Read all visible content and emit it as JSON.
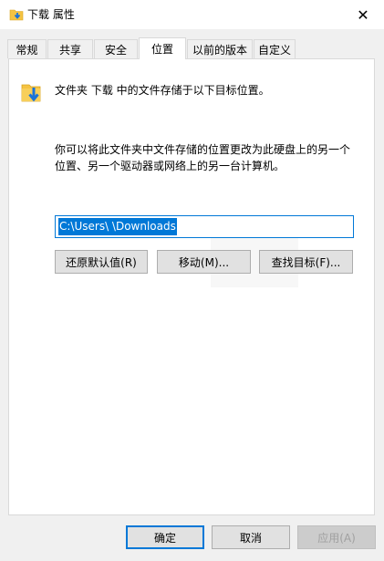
{
  "window": {
    "title": "下载 属性"
  },
  "tabs": [
    {
      "label": "常规",
      "active": false
    },
    {
      "label": "共享",
      "active": false
    },
    {
      "label": "安全",
      "active": false
    },
    {
      "label": "位置",
      "active": true
    },
    {
      "label": "以前的版本",
      "active": false
    },
    {
      "label": "自定义",
      "active": false
    }
  ],
  "location": {
    "description": "文件夹 下载 中的文件存储于以下目标位置。",
    "info_line1": "你可以将此文件夹中文件存储的位置更改为此硬盘上的另一个",
    "info_line2": "位置、另一个驱动器或网络上的另一台计算机。",
    "path": "C:\\Users\\        \\Downloads",
    "buttons": {
      "restore": "还原默认值(R)",
      "move": "移动(M)...",
      "find": "查找目标(F)..."
    }
  },
  "footer": {
    "ok": "确定",
    "cancel": "取消",
    "apply": "应用(A)"
  },
  "colors": {
    "accent": "#0078d7",
    "folder": "#f5c342",
    "arrow": "#1a73d9"
  },
  "icons": [
    "folder-download-icon",
    "close-icon"
  ]
}
